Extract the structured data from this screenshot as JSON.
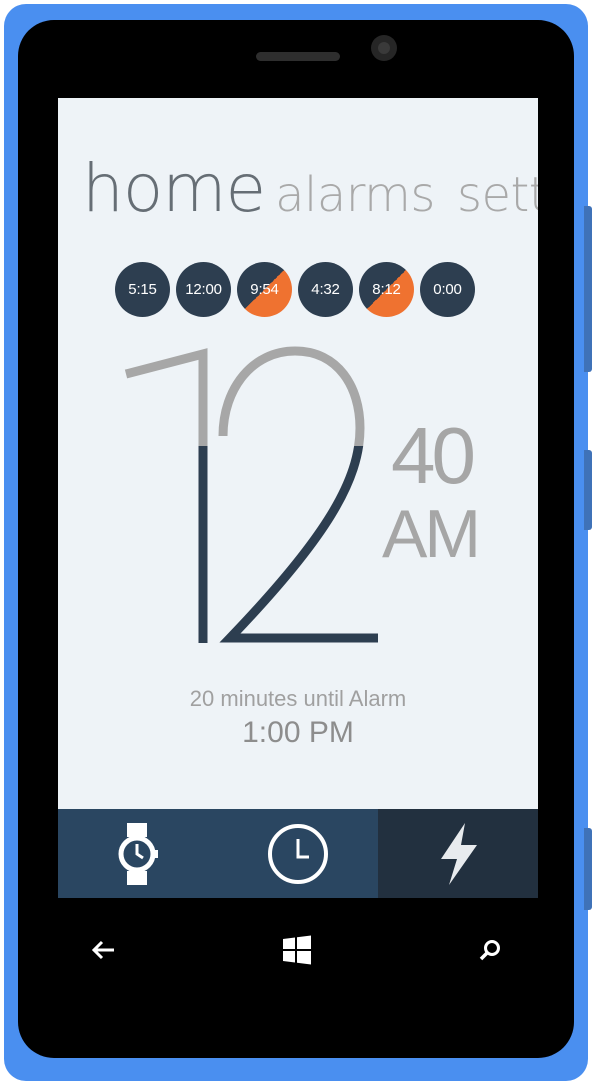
{
  "pivot": {
    "items": [
      "home",
      "alarms",
      "sett"
    ]
  },
  "alarm_chips": [
    {
      "label": "5:15",
      "state": "off"
    },
    {
      "label": "12:00",
      "state": "off"
    },
    {
      "label": "9:54",
      "state": "on"
    },
    {
      "label": "4:32",
      "state": "off"
    },
    {
      "label": "8:12",
      "state": "on"
    },
    {
      "label": "0:00",
      "state": "off"
    }
  ],
  "clock": {
    "hour": "12",
    "minutes": "40",
    "ampm": "AM"
  },
  "next_alarm": {
    "until_text": "20 minutes until Alarm",
    "time": "1:00 PM"
  },
  "app_bar": {
    "buttons": [
      "watch-icon",
      "clock-icon",
      "lightning-icon"
    ]
  },
  "system_nav": [
    "back-arrow-icon",
    "windows-start-icon",
    "search-icon"
  ],
  "colors": {
    "phone_frame": "#4a8ff0",
    "screen_bg": "#eef3f7",
    "chip_dark": "#2d3e50",
    "accent_orange": "#ef7230",
    "app_bar_active": "#2a4661",
    "app_bar_dark": "#22303f"
  }
}
